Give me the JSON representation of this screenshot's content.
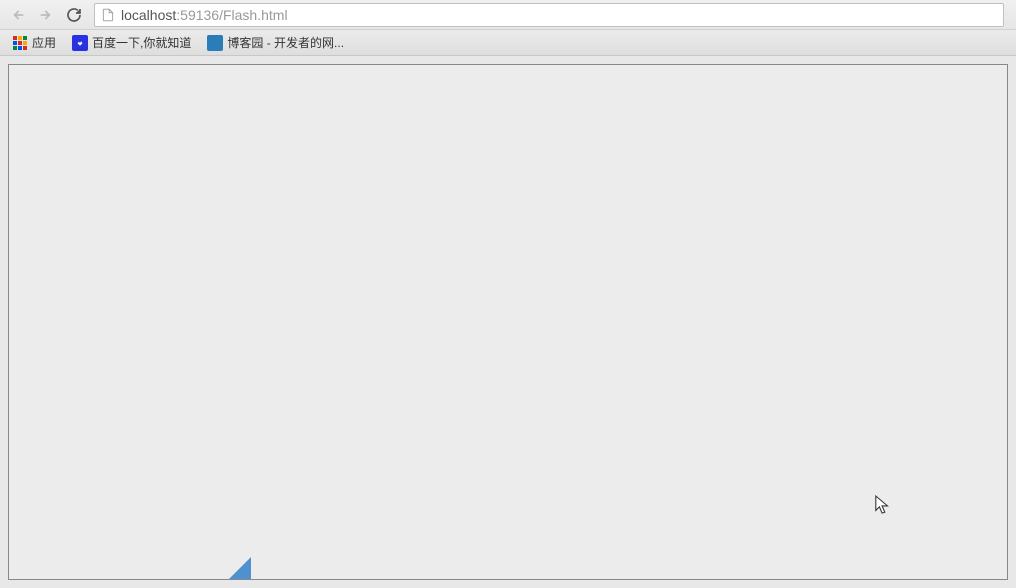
{
  "navigation": {
    "back_enabled": false,
    "forward_enabled": false
  },
  "address": {
    "host": "localhost",
    "port_path": ":59136/Flash.html"
  },
  "bookmarks": {
    "apps_label": "应用",
    "items": [
      {
        "label": "百度一下,你就知道",
        "icon": "baidu"
      },
      {
        "label": "博客园 - 开发者的网...",
        "icon": "cnblogs"
      }
    ]
  }
}
